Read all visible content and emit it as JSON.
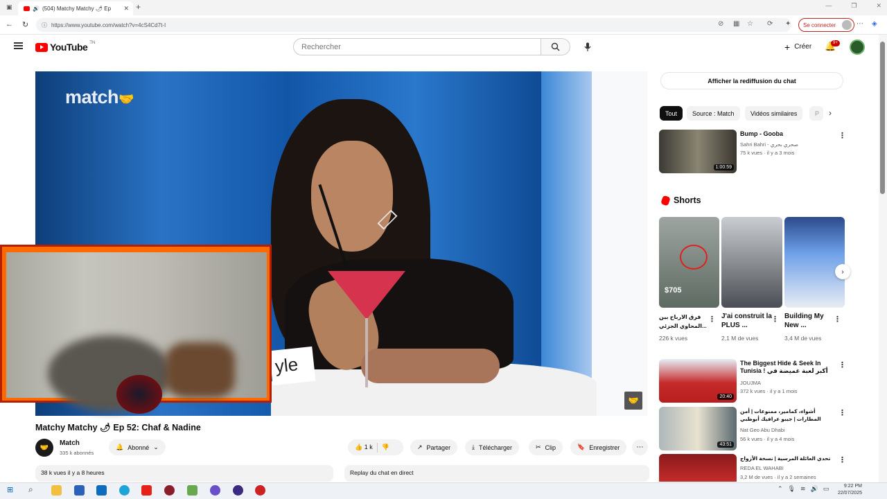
{
  "browser": {
    "tab_title": "(504) Matchy Matchy 🌶 Ep",
    "url": "https://www.youtube.com/watch?v=4cS4Cd7t-I",
    "signin_label": "Se connecter",
    "window_controls": [
      "—",
      "❐",
      "✕"
    ]
  },
  "header": {
    "logo_text": "YouTube",
    "logo_region": "TN",
    "search_placeholder": "Rechercher",
    "create_label": "Créer",
    "notifications_badge": "9+"
  },
  "video": {
    "overlay_logo": "match",
    "card_text": "yle",
    "title": "Matchy Matchy 🌶 Ep 52: Chaf & Nadine",
    "channel": "Match",
    "subscribers": "335 k abonnés",
    "subscribe_label": "Abonné",
    "likes": "1 k",
    "share_label": "Partager",
    "download_label": "Télécharger",
    "clip_label": "Clip",
    "save_label": "Enregistrer",
    "views_time": "38 k vues  il y a 8 heures",
    "replay_label": "Replay du chat en direct"
  },
  "sidebar": {
    "chat_replay_button": "Afficher la rediffusion du chat",
    "chips": [
      "Tout",
      "Source : Match",
      "Vidéos similaires",
      "P"
    ],
    "videos": [
      {
        "title": "Bump - Gooba",
        "channel": "Sahri Bahri - صحري بحري",
        "meta": "75 k vues · il y a 3 mois",
        "duration": "1:00:59"
      },
      {
        "title": "The Biggest Hide & Seek In Tunisia ! أكبر لعبة غميضة في تونس",
        "channel": "JOUJMA",
        "meta": "372 k vues · il y a 1 mois",
        "duration": "20:40"
      },
      {
        "title": "أشواء، كمامير، ممنوعات | أمن المطارات | جيبو عرافيك أبوظبي",
        "channel": "Nat Geo Abu Dhabi",
        "meta": "56 k vues · il y a 4 mois",
        "duration": "43:51"
      },
      {
        "title": "تحدي العائلة المرسية | نسخة الأزواج",
        "channel": "REDA EL WAHABI",
        "meta": "3,2 M de vues · il y a 2 semaines",
        "duration": ""
      }
    ],
    "shorts_heading": "Shorts",
    "shorts": [
      {
        "title": "فرق الارباح بين المحاوي الجزئي...",
        "views": "226 k vues",
        "thumb_text": "$705"
      },
      {
        "title": "J'ai construit la PLUS ...",
        "views": "2,1 M de vues",
        "thumb_text": ""
      },
      {
        "title": "Building My New ...",
        "views": "3,4 M de vues",
        "thumb_text": ""
      }
    ]
  },
  "taskbar": {
    "time": "9:22 PM",
    "date": "22/07/2025"
  },
  "colors": {
    "accent_red": "#ff0000",
    "chip_active": "#0f0f0f"
  }
}
